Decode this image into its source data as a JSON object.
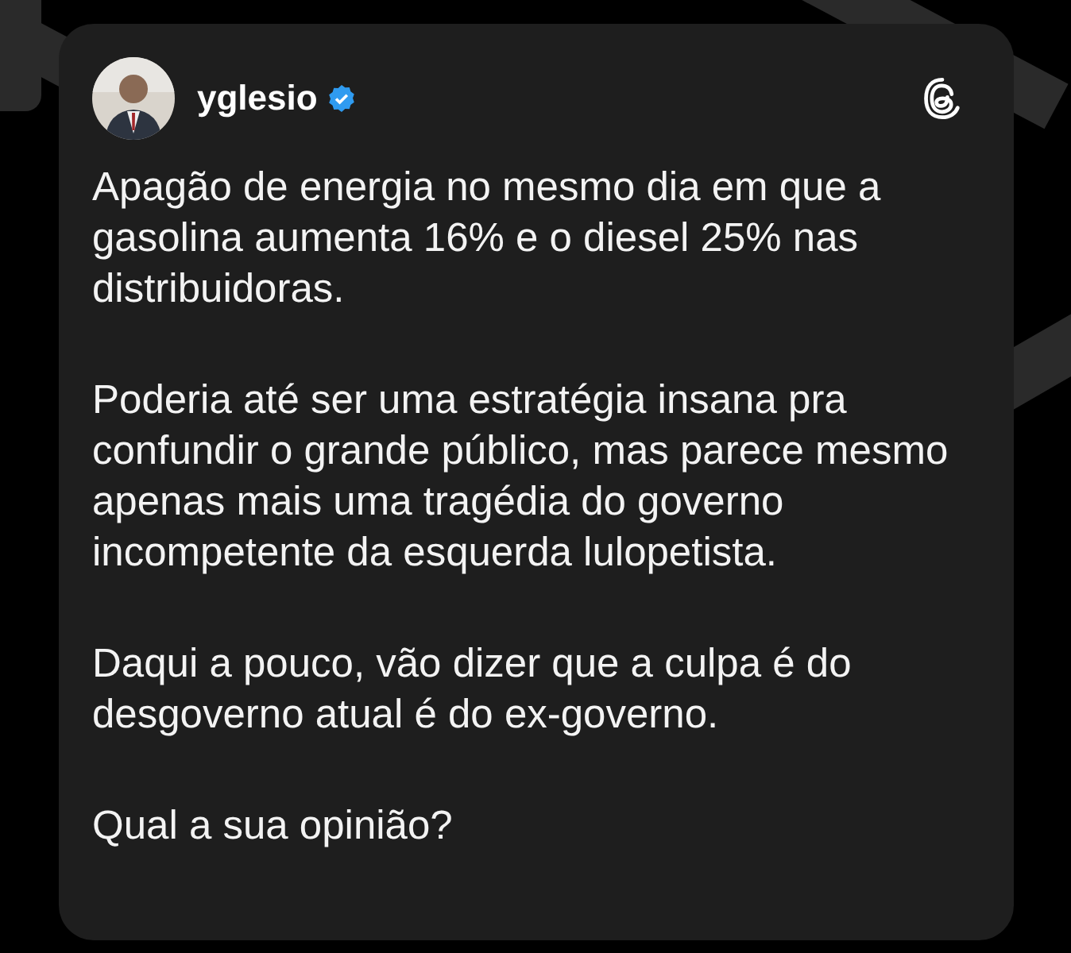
{
  "post": {
    "author": {
      "username": "yglesio",
      "verified": true
    },
    "paragraphs": [
      "Apagão de energia no mesmo dia em que a\ngasolina aumenta 16% e o diesel 25% nas\ndistribuidoras.",
      "Poderia até ser uma estratégia insana pra\nconfundir o grande público, mas parece mesmo\napenas mais uma tragédia do governo\nincompetente da esquerda lulopetista.",
      "Daqui a pouco, vão dizer que a culpa é do\ndesgoverno atual é do ex-governo.",
      "Qual a sua opinião?"
    ]
  }
}
